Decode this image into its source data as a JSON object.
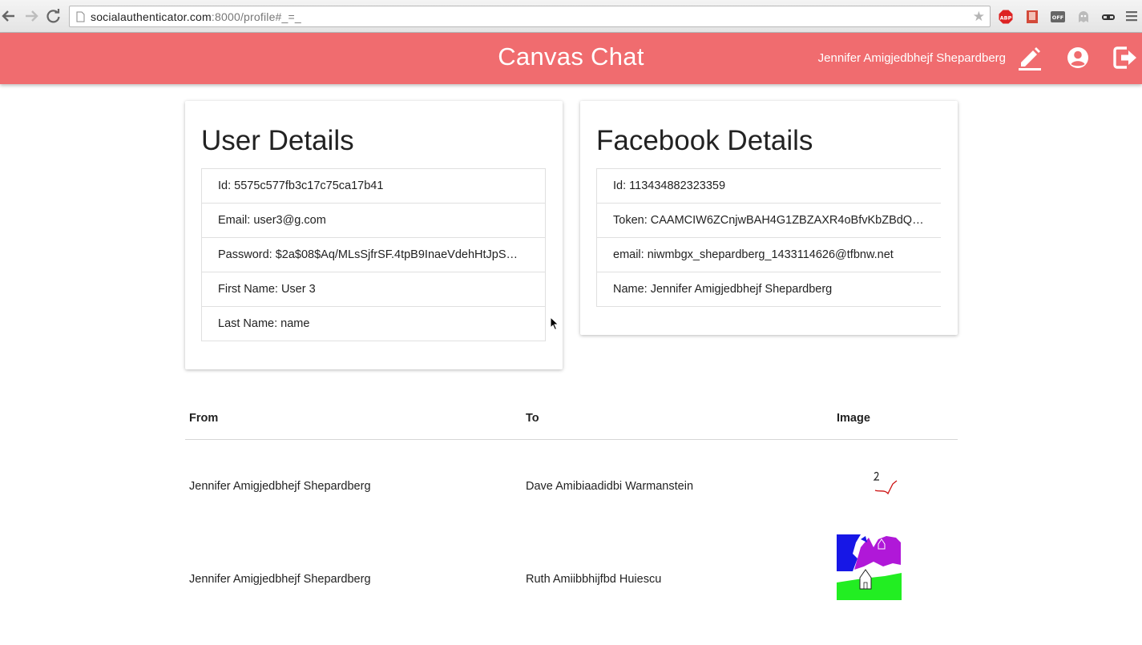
{
  "browser": {
    "url_host": "socialauthenticator.com",
    "url_rest": ":8000/profile#_=_",
    "extensions": [
      "abp-icon",
      "bookmark-icon",
      "off-icon",
      "ghost-icon",
      "mask-icon"
    ],
    "extension_labels": {
      "abp": "ABP",
      "off": "OFF"
    }
  },
  "header": {
    "title": "Canvas Chat",
    "user_name": "Jennifer Amigjedbhejf Shepardberg",
    "bg_color": "#f06c6f"
  },
  "user_details": {
    "title": "User Details",
    "items": [
      "Id: 5575c577fb3c17c75ca17b41",
      "Email: user3@g.com",
      "Password: $2a$08$Aq/MLsSjfrSF.4tpB9InaeVdehHtJpS…",
      "First Name: User 3",
      "Last Name: name"
    ]
  },
  "facebook_details": {
    "title": "Facebook Details",
    "items": [
      "Id: 113434882323359",
      "Token: CAAMCIW6ZCnjwBAH4G1ZBZAXR4oBfvKbZBdQ…",
      "email: niwmbgx_shepardberg_1433114626@tfbnw.net",
      "Name: Jennifer Amigjedbhejf Shepardberg"
    ]
  },
  "messages_table": {
    "headers": {
      "from": "From",
      "to": "To",
      "image": "Image"
    },
    "rows": [
      {
        "from": "Jennifer Amigjedbhejf Shepardberg",
        "to": "Dave Amibiaadidbi Warmanstein",
        "image": "doodle-sketch"
      },
      {
        "from": "Jennifer Amigjedbhejf Shepardberg",
        "to": "Ruth Amiibbhijfbd Huiescu",
        "image": "colorful-house-drawing"
      }
    ]
  }
}
